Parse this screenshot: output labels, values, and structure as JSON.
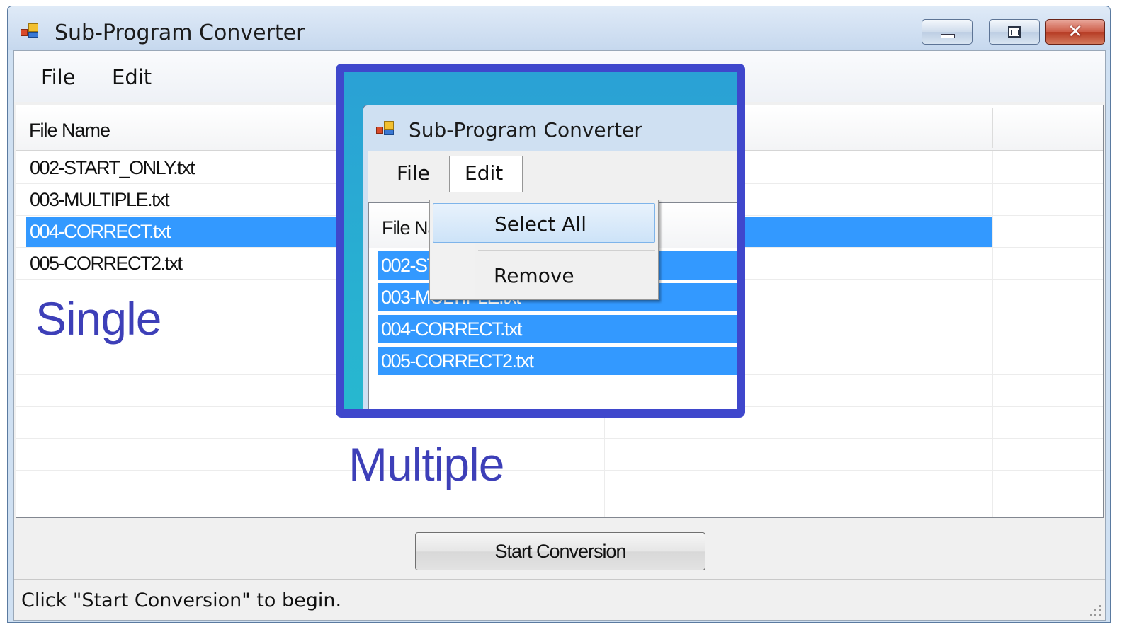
{
  "window": {
    "title": "Sub-Program Converter",
    "buttons": {
      "minimize": "minimize-icon",
      "maximize": "maximize-icon",
      "close": "✕"
    }
  },
  "menu": {
    "file": "File",
    "edit": "Edit"
  },
  "list": {
    "column_header": "File Name",
    "rows": [
      {
        "name": "002-START_ONLY.txt",
        "selected": false
      },
      {
        "name": "003-MULTIPLE.txt",
        "selected": false
      },
      {
        "name": "004-CORRECT.txt",
        "selected": true
      },
      {
        "name": "005-CORRECT2.txt",
        "selected": false
      }
    ]
  },
  "annotations": {
    "single": "Single",
    "multiple": "Multiple"
  },
  "inset": {
    "title": "Sub-Program Converter",
    "menu": {
      "file": "File",
      "edit": "Edit"
    },
    "column_header": "File Nar",
    "rows": [
      "002-ST",
      "003-MULTIPLE.txt",
      "004-CORRECT.txt",
      "005-CORRECT2.txt"
    ],
    "context_menu": {
      "select_all": "Select All",
      "remove": "Remove"
    },
    "highlight_color": "#3f47cc"
  },
  "actions": {
    "start_conversion": "Start Conversion"
  },
  "status": {
    "text": "Click \"Start Conversion\" to begin."
  },
  "colors": {
    "selection": "#3399ff",
    "annotation": "#3d3fb8"
  }
}
